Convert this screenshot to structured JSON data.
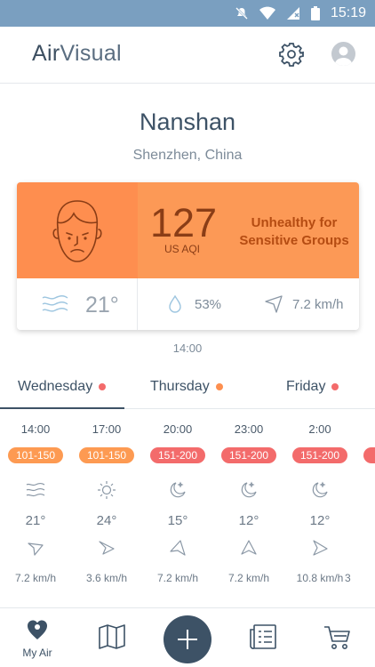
{
  "status": {
    "time": "15:19"
  },
  "app": {
    "logo_air": "Air",
    "logo_visual": "Visual"
  },
  "location": {
    "city": "Nanshan",
    "region": "Shenzhen, China"
  },
  "aqi": {
    "value": "127",
    "unit": "US AQI",
    "level_line1": "Unhealthy for",
    "level_line2": "Sensitive Groups",
    "color": "#fc9956"
  },
  "weather": {
    "temperature": "21°",
    "humidity": "53%",
    "wind": "7.2 km/h"
  },
  "updated_time": "14:00",
  "days": [
    {
      "label": "Wednesday",
      "dot": "#f36b6b"
    },
    {
      "label": "Thursday",
      "dot": "#fd8f4f"
    },
    {
      "label": "Friday",
      "dot": "#f36b6b"
    }
  ],
  "forecast": [
    {
      "time": "14:00",
      "aqi": "101-150",
      "color": "#fd9a52",
      "icon": "wind-icon",
      "temp": "21°",
      "wind": "7.2 km/h"
    },
    {
      "time": "17:00",
      "aqi": "101-150",
      "color": "#fd9a52",
      "icon": "sun-icon",
      "temp": "24°",
      "wind": "3.6 km/h"
    },
    {
      "time": "20:00",
      "aqi": "151-200",
      "color": "#f36b6b",
      "icon": "moon-icon",
      "temp": "15°",
      "wind": "7.2 km/h"
    },
    {
      "time": "23:00",
      "aqi": "151-200",
      "color": "#f36b6b",
      "icon": "moon-icon",
      "temp": "12°",
      "wind": "7.2 km/h"
    },
    {
      "time": "2:00",
      "aqi": "151-200",
      "color": "#f36b6b",
      "icon": "moon-icon",
      "temp": "12°",
      "wind": "10.8 km/h"
    },
    {
      "time": "",
      "aqi": "",
      "color": "#f36b6b",
      "icon": "",
      "temp": "",
      "wind": "3"
    }
  ],
  "nav": {
    "my_air": "My Air"
  },
  "colors": {
    "primary": "#3d5266",
    "accent_orange": "#fc9956",
    "accent_red": "#f36b6b"
  }
}
